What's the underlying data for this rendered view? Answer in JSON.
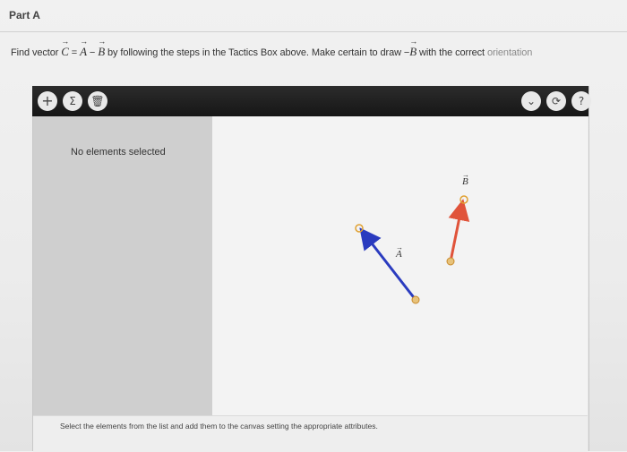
{
  "part_label": "Part A",
  "instruction": {
    "prefix": "Find vector ",
    "var_c": "C",
    "eq": " = ",
    "var_a": "A",
    "minus": " − ",
    "var_b": "B",
    "text1": " by following the steps in the Tactics Box above. Make certain to draw ",
    "neg_b": "−",
    "var_b2": "B",
    "text2": " with the correct ",
    "faded_word": "orientation"
  },
  "toolbar": {
    "add_glyph": "+",
    "sum_glyph": "Σ",
    "trash_glyph": "🗑",
    "dropdown_glyph": "⌄",
    "reset_glyph": "⟳",
    "help_glyph": "?"
  },
  "left_panel": {
    "empty_text": "No elements selected"
  },
  "canvas": {
    "vectors": [
      {
        "label": "A",
        "color": "#2a3bbf"
      },
      {
        "label": "B",
        "color": "#e0533a"
      }
    ],
    "handle_color": "#e0a030"
  },
  "status": {
    "text": "Select the elements from the list and add them to the canvas setting the appropriate attributes."
  }
}
